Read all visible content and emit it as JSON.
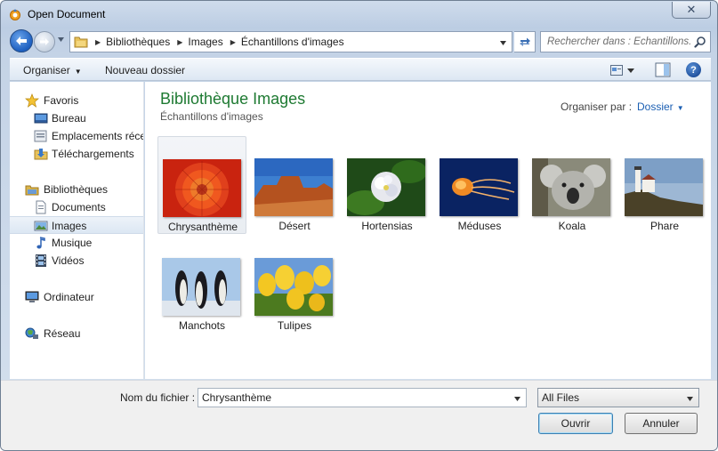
{
  "window": {
    "title": "Open Document",
    "close_label": "✕"
  },
  "address": {
    "crumbs": [
      "Bibliothèques",
      "Images",
      "Échantillons d'images"
    ],
    "search_placeholder": "Rechercher dans : Échantillons..."
  },
  "toolbar": {
    "organize_label": "Organiser",
    "new_folder_label": "Nouveau dossier",
    "help_label": "?"
  },
  "sidebar": {
    "items": [
      {
        "label": "Favoris",
        "icon": "star-icon",
        "level": "top",
        "selected": false
      },
      {
        "label": "Bureau",
        "icon": "desktop-icon",
        "level": "sub",
        "selected": false
      },
      {
        "label": "Emplacements récents",
        "icon": "recent-places-icon",
        "level": "sub",
        "selected": false
      },
      {
        "label": "Téléchargements",
        "icon": "downloads-folder-icon",
        "level": "sub",
        "selected": false
      },
      {
        "label": "Bibliothèques",
        "icon": "libraries-icon",
        "level": "top",
        "selected": false
      },
      {
        "label": "Documents",
        "icon": "documents-icon",
        "level": "sub",
        "selected": false
      },
      {
        "label": "Images",
        "icon": "pictures-icon",
        "level": "sub",
        "selected": true
      },
      {
        "label": "Musique",
        "icon": "music-icon",
        "level": "sub",
        "selected": false
      },
      {
        "label": "Vidéos",
        "icon": "videos-icon",
        "level": "sub",
        "selected": false
      },
      {
        "label": "Ordinateur",
        "icon": "computer-icon",
        "level": "top",
        "selected": false
      },
      {
        "label": "Réseau",
        "icon": "network-icon",
        "level": "top",
        "selected": false
      }
    ]
  },
  "content": {
    "title": "Bibliothèque Images",
    "subtitle": "Échantillons d'images",
    "arrange_label": "Organiser par :",
    "arrange_value": "Dossier",
    "files": [
      {
        "name": "Chrysanthème",
        "selected": true
      },
      {
        "name": "Désert",
        "selected": false
      },
      {
        "name": "Hortensias",
        "selected": false
      },
      {
        "name": "Méduses",
        "selected": false
      },
      {
        "name": "Koala",
        "selected": false
      },
      {
        "name": "Phare",
        "selected": false
      },
      {
        "name": "Manchots",
        "selected": false
      },
      {
        "name": "Tulipes",
        "selected": false
      }
    ]
  },
  "footer": {
    "filename_label": "Nom du fichier :",
    "filename_value": "Chrysanthème",
    "filter_value": "All Files",
    "open_label": "Ouvrir",
    "cancel_label": "Annuler"
  },
  "colors": {
    "library_title": "#1e7a32",
    "link": "#1b5fb3",
    "selection": "#dce7f3"
  }
}
